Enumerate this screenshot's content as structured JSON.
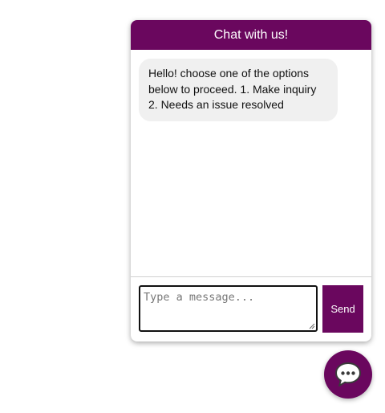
{
  "chat": {
    "title": "Chat with us!",
    "messages": [
      {
        "sender": "bot",
        "text": "Hello! choose one of the options below to proceed. 1. Make inquiry 2. Needs an issue resolved"
      }
    ],
    "input": {
      "placeholder": "Type a message...",
      "value": ""
    },
    "send_label": "Send"
  },
  "launcher": {
    "icon": "speech-bubble-icon"
  },
  "colors": {
    "brand": "#6a075e",
    "bubble_bg": "#f0f0f0",
    "text": "#111111"
  }
}
